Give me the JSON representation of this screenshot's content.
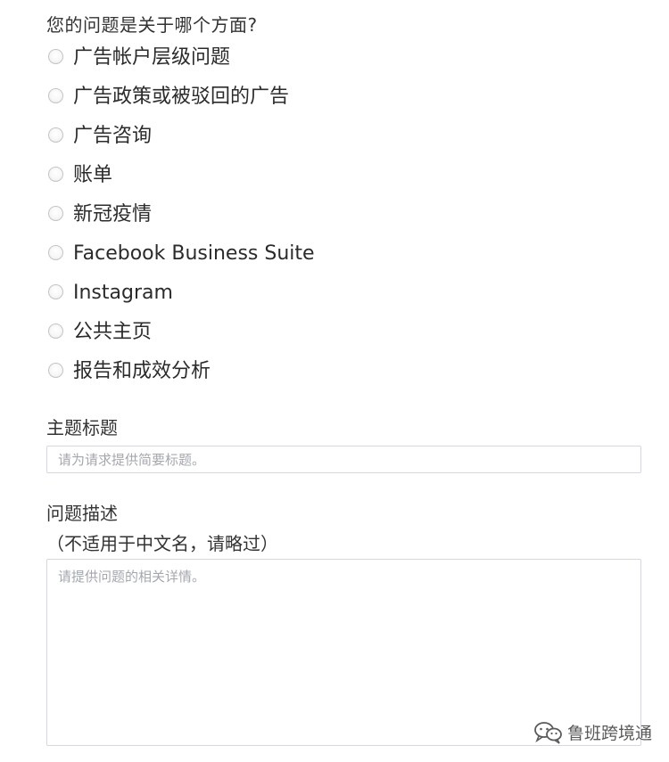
{
  "question": "您的问题是关于哪个方面?",
  "options": [
    {
      "label": "广告帐户层级问题"
    },
    {
      "label": "广告政策或被驳回的广告"
    },
    {
      "label": "广告咨询"
    },
    {
      "label": "账单"
    },
    {
      "label": "新冠疫情"
    },
    {
      "label": "Facebook Business Suite"
    },
    {
      "label": "Instagram"
    },
    {
      "label": "公共主页"
    },
    {
      "label": "报告和成效分析"
    }
  ],
  "subject": {
    "label": "主题标题",
    "placeholder": "请为请求提供简要标题。",
    "value": ""
  },
  "description": {
    "label": "问题描述",
    "note": "（不适用于中文名，请略过）",
    "placeholder": "请提供问题的相关详情。",
    "value": ""
  },
  "watermark": {
    "icon": "wechat-icon",
    "text": "鲁班跨境通"
  }
}
